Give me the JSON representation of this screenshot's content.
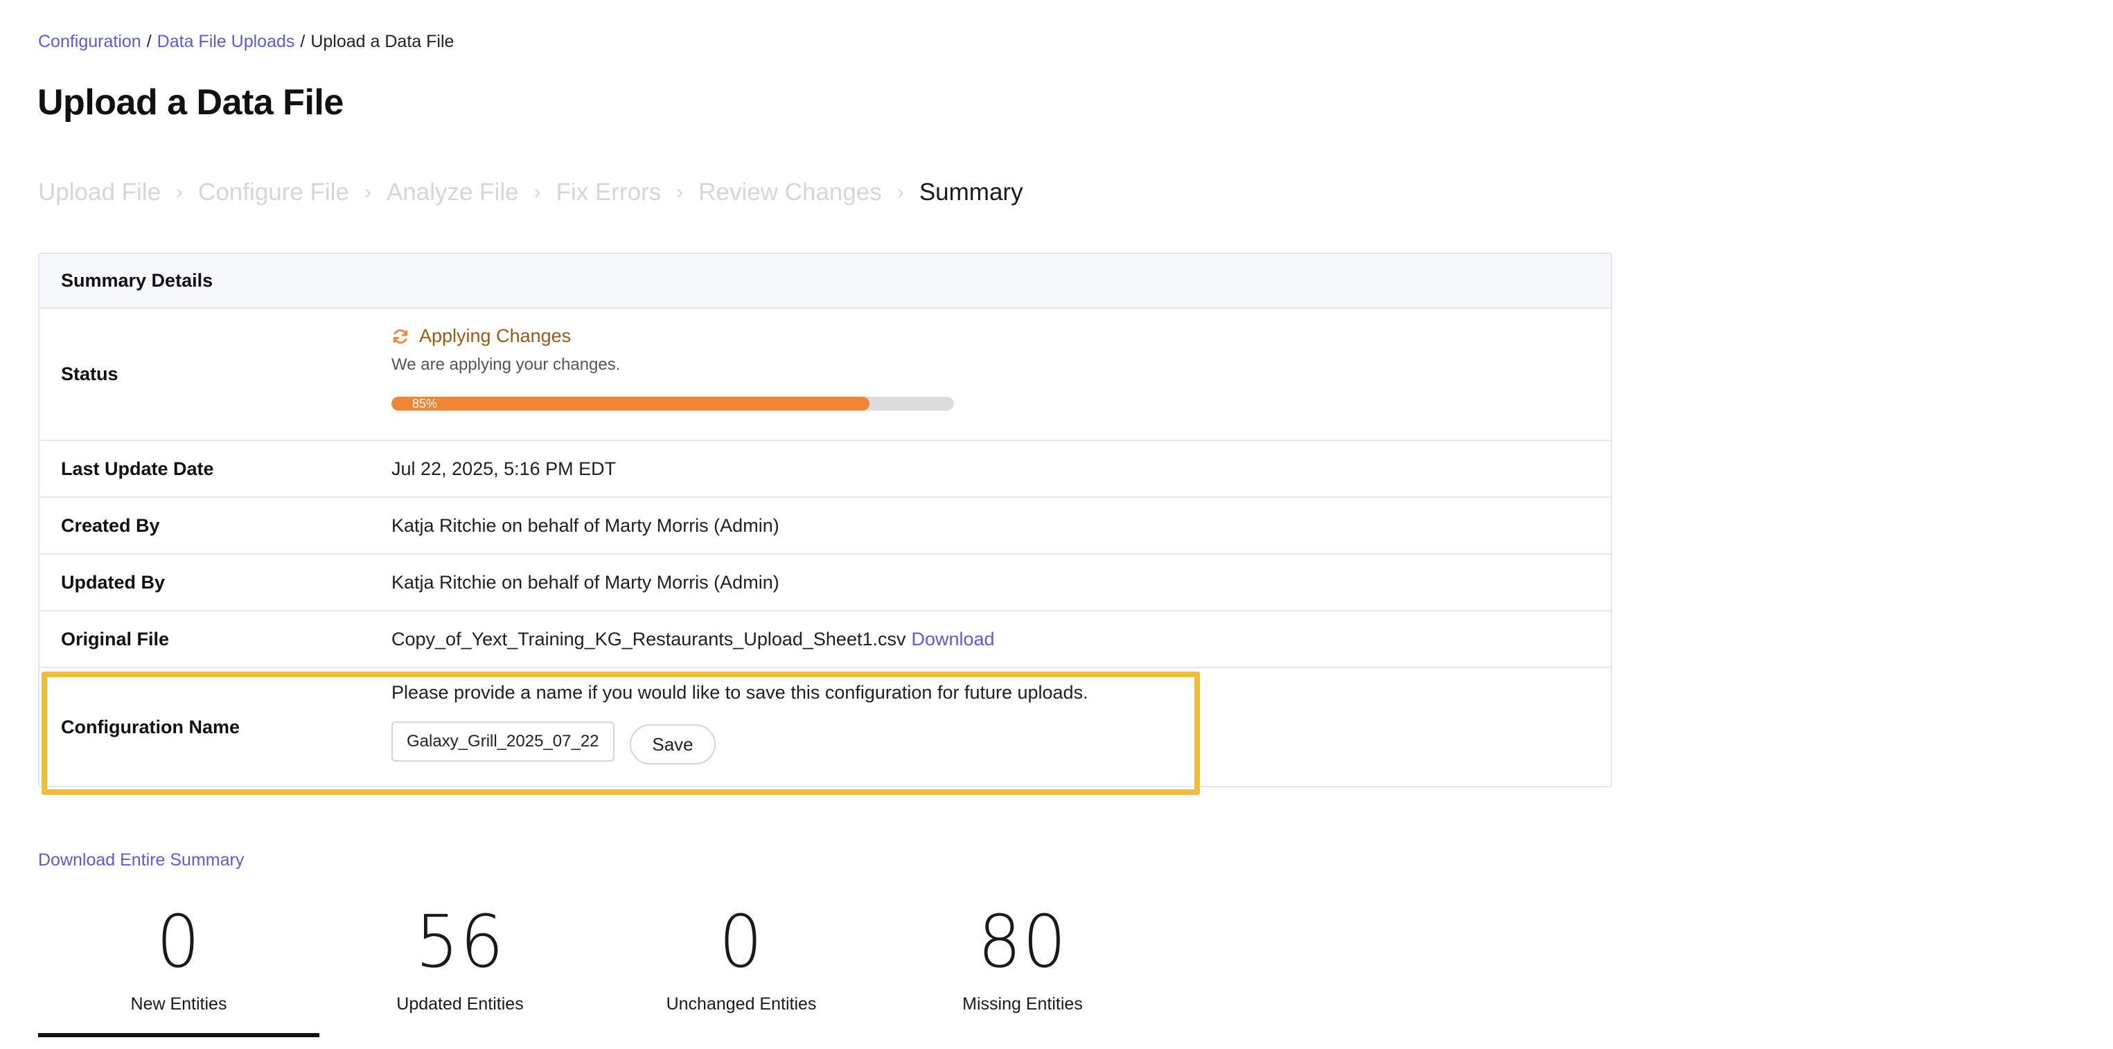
{
  "breadcrumb": {
    "items": [
      "Configuration",
      "Data File Uploads",
      "Upload a Data File"
    ],
    "separator": "/"
  },
  "page_title": "Upload a Data File",
  "steps": [
    "Upload File",
    "Configure File",
    "Analyze File",
    "Fix Errors",
    "Review Changes",
    "Summary"
  ],
  "step_separator": "›",
  "summary": {
    "header": "Summary Details",
    "status": {
      "label": "Status",
      "title": "Applying Changes",
      "description": "We are applying your changes.",
      "progress_percent": 85,
      "progress_text": "85%"
    },
    "last_update": {
      "label": "Last Update Date",
      "value": "Jul 22, 2025, 5:16 PM EDT"
    },
    "created_by": {
      "label": "Created By",
      "value": "Katja Ritchie on behalf of Marty Morris (Admin)"
    },
    "updated_by": {
      "label": "Updated By",
      "value": "Katja Ritchie on behalf of Marty Morris (Admin)"
    },
    "original_file": {
      "label": "Original File",
      "filename": "Copy_of_Yext_Training_KG_Restaurants_Upload_Sheet1.csv",
      "download_label": "Download"
    },
    "configuration": {
      "label": "Configuration Name",
      "prompt": "Please provide a name if you would like to save this configuration for future uploads.",
      "input_value": "Galaxy_Grill_2025_07_22",
      "save_label": "Save"
    }
  },
  "download_summary_label": "Download Entire Summary",
  "stats": [
    {
      "number": "0",
      "label": "New Entities",
      "active": true
    },
    {
      "number": "56",
      "label": "Updated Entities",
      "active": false
    },
    {
      "number": "0",
      "label": "Unchanged Entities",
      "active": false
    },
    {
      "number": "80",
      "label": "Missing Entities",
      "active": false
    }
  ],
  "colors": {
    "link": "#5a5adf",
    "progress_fill": "#f08534",
    "status_text": "#9a5a14",
    "highlight": "#f0bc3c"
  }
}
